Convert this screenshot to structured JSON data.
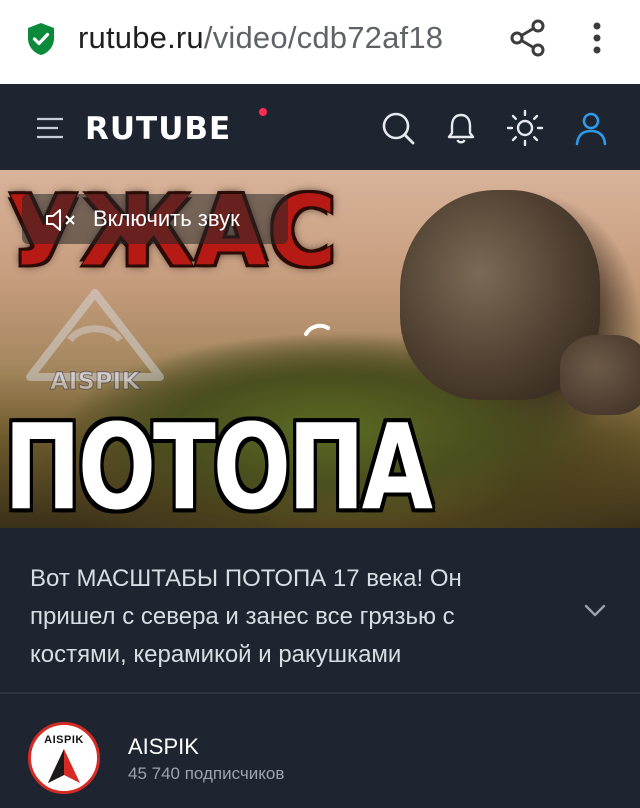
{
  "browser": {
    "url_domain": "rutube.ru",
    "url_path": "/video/cdb72af18"
  },
  "header": {
    "logo": "RUTUBE",
    "accent_color": "#2f9be8",
    "icons": [
      "menu-icon",
      "search-icon",
      "bell-icon",
      "theme-sun-icon",
      "user-icon"
    ]
  },
  "video": {
    "overlay_title_top": "УЖАС",
    "overlay_title_bottom": "ПОТОПА",
    "watermark": "AISPIK",
    "unmute_label": "Включить звук"
  },
  "description": {
    "text": "Вот МАСШТАБЫ ПОТОПА 17 века! Он пришел с севера и занес все грязью с костями, керамикой и ракушками"
  },
  "channel": {
    "avatar_text": "AISPIK",
    "name": "AISPIK",
    "subscribers": "45 740 подписчиков"
  }
}
